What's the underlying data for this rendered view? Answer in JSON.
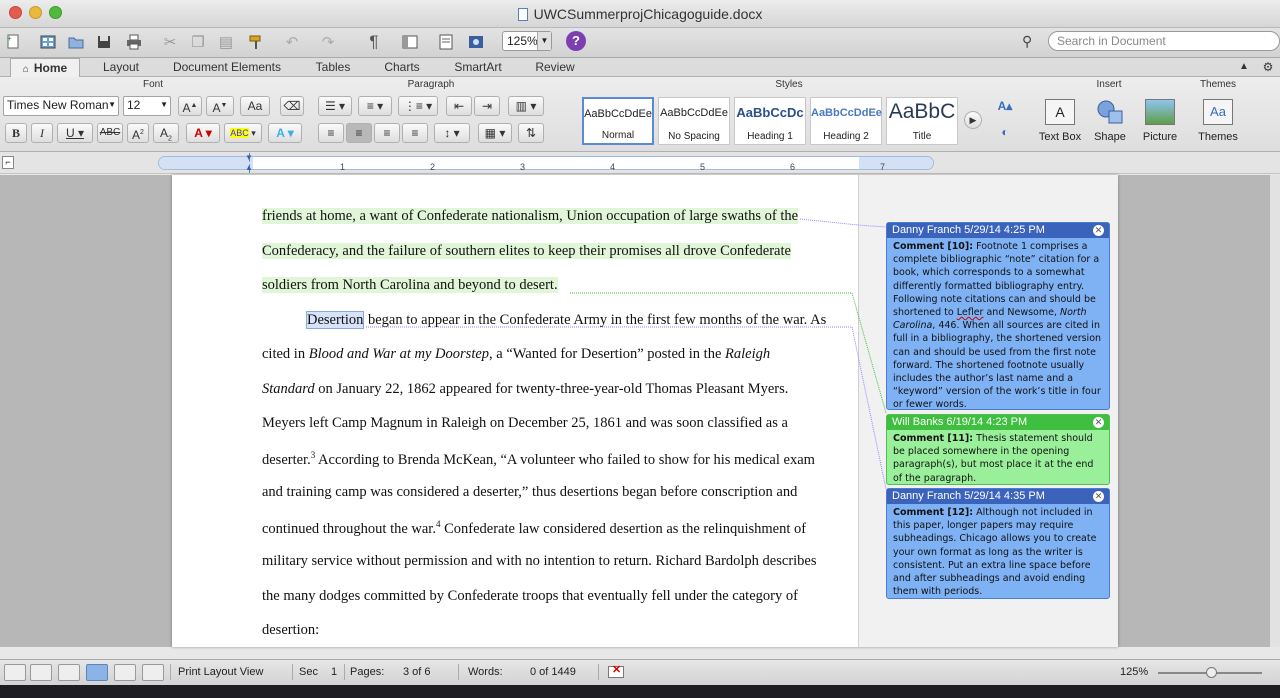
{
  "window": {
    "title": "UWCSummerprojChicagoguide.docx"
  },
  "toolbar": {
    "zoom": "125%",
    "search_placeholder": "Search in Document",
    "help": "?"
  },
  "tabs": [
    "Home",
    "Layout",
    "Document Elements",
    "Tables",
    "Charts",
    "SmartArt",
    "Review"
  ],
  "ribbon": {
    "groups": {
      "font": "Font",
      "paragraph": "Paragraph",
      "styles": "Styles",
      "insert": "Insert",
      "themes": "Themes"
    },
    "font_name": "Times New Roman",
    "font_size": "12",
    "styles": [
      {
        "preview": "AaBbCcDdEe",
        "name": "Normal"
      },
      {
        "preview": "AaBbCcDdEe",
        "name": "No Spacing"
      },
      {
        "preview": "AaBbCcDc",
        "name": "Heading 1"
      },
      {
        "preview": "AaBbCcDdEe",
        "name": "Heading 2"
      },
      {
        "preview": "AaBbC",
        "name": "Title"
      }
    ],
    "insert": [
      "Text Box",
      "Shape",
      "Picture"
    ],
    "themes_label": "Themes"
  },
  "ruler": {
    "numbers": [
      "1",
      "2",
      "3",
      "4",
      "5",
      "6",
      "7"
    ]
  },
  "document": {
    "lines": [
      "friends at home, a want of Confederate nationalism, Union occupation of large swaths of the",
      "Confederacy, and the failure of southern elites to keep their promises all drove Confederate",
      "soldiers from North Carolina and beyond to desert.",
      "began to appear in the Confederate Army in the first few months of the war. As",
      "cited in",
      "Blood and War at my Doorstep",
      ", a “Wanted for Desertion” posted in the",
      "Raleigh",
      "Standard",
      " on January 22, 1862 appeared for twenty-three-year-old Thomas Pleasant Myers.",
      "Meyers left Camp Magnum in Raleigh on December 25, 1861 and was soon classified as a",
      "deserter.",
      "3",
      " According to Brenda McKean, “A volunteer who failed to show for his medical exam",
      "and training camp was considered a deserter,” thus desertions began before conscription and",
      "continued throughout the war.",
      "4",
      " Confederate law considered desertion as the relinquishment of",
      "military service without permission and with no intention to return. Richard Bardolph describes",
      "the many dodges committed by Confederate troops that eventually fell under the category of",
      "desertion:"
    ],
    "desertion_word": "Desertion"
  },
  "comments": [
    {
      "header": "Danny Franch 5/29/14 4:25 PM",
      "label": "Comment [10]:",
      "text1": " Footnote 1 comprises a complete bibliographic “note” citation for a book, which corresponds to a somewhat differently formatted bibliography entry. Following note citations can and should be shortened to ",
      "lefler": "Lefler",
      "text2": " and Newsome, ",
      "italic": "North Carolina",
      "text3": ", 446. When all sources are cited in full in a bibliography, the shortened version can and should be used from the first note forward. The shortened footnote usually includes the author’s last name and a “keyword” version of the work’s title in four or fewer words.",
      "color": "#3b63bc"
    },
    {
      "header": "Will Banks 6/19/14 4:23 PM",
      "label": "Comment [11]:",
      "text": " Thesis statement should be placed somewhere in the opening paragraph(s), but most place it at the end of the paragraph.",
      "color": "#3fbf3f"
    },
    {
      "header": "Danny Franch 5/29/14 4:35 PM",
      "label": "Comment [12]:",
      "text": " Although not included in this paper, longer papers may require subheadings. Chicago allows you to create your own format as long as the writer is consistent. Put an extra line space before and after subheadings and avoid ending them with periods.",
      "color": "#3b63bc"
    }
  ],
  "status": {
    "view": "Print Layout View",
    "sec_label": "Sec",
    "sec": "1",
    "pages_label": "Pages:",
    "pages": "3 of 6",
    "words_label": "Words:",
    "words": "0 of 1449",
    "zoom": "125%"
  }
}
